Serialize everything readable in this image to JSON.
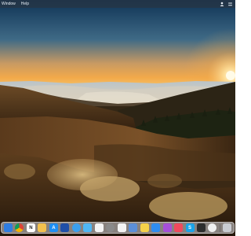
{
  "menubar": {
    "items": [
      "Window",
      "Help"
    ]
  },
  "dock": {
    "apps": [
      {
        "name": "finder-icon",
        "color": "#2f7de1",
        "glyph": ""
      },
      {
        "name": "chrome-icon",
        "color": "#e8e8e8",
        "glyph": ""
      },
      {
        "name": "notion-icon",
        "color": "#ffffff",
        "glyph": "N"
      },
      {
        "name": "folder-icon",
        "color": "#f2c14e",
        "glyph": ""
      },
      {
        "name": "app-store-icon",
        "color": "#1e8ef3",
        "glyph": "A"
      },
      {
        "name": "shield-icon",
        "color": "#1f4fa8",
        "glyph": ""
      },
      {
        "name": "safari-icon",
        "color": "#3aa0f0",
        "glyph": ""
      },
      {
        "name": "cloud-icon",
        "color": "#4fb7f4",
        "glyph": ""
      },
      {
        "name": "calendar-icon",
        "color": "#f4f4f4",
        "glyph": ""
      },
      {
        "name": "settings-icon",
        "color": "#8a8a8a",
        "glyph": ""
      },
      {
        "name": "photos-icon",
        "color": "#f4f4f4",
        "glyph": ""
      },
      {
        "name": "preview-icon",
        "color": "#5b8fd9",
        "glyph": ""
      },
      {
        "name": "notes-icon",
        "color": "#f5d24a",
        "glyph": ""
      },
      {
        "name": "mail-icon",
        "color": "#2f8df0",
        "glyph": ""
      },
      {
        "name": "podcast-icon",
        "color": "#a64fd8",
        "glyph": ""
      },
      {
        "name": "music-icon",
        "color": "#f04a5d",
        "glyph": ""
      },
      {
        "name": "skype-icon",
        "color": "#1aa3e8",
        "glyph": "S"
      },
      {
        "name": "terminal-icon",
        "color": "#2d2d2d",
        "glyph": ""
      },
      {
        "name": "chatgpt-icon",
        "color": "#f0f0f0",
        "glyph": ""
      },
      {
        "name": "trash-icon",
        "color": "#c9ccd2",
        "glyph": ""
      }
    ]
  },
  "colors": {
    "menubar_bg": "#283442",
    "sky_top": "#0f3355",
    "horizon": "#f2a94a",
    "sun": "#fff6d8"
  }
}
